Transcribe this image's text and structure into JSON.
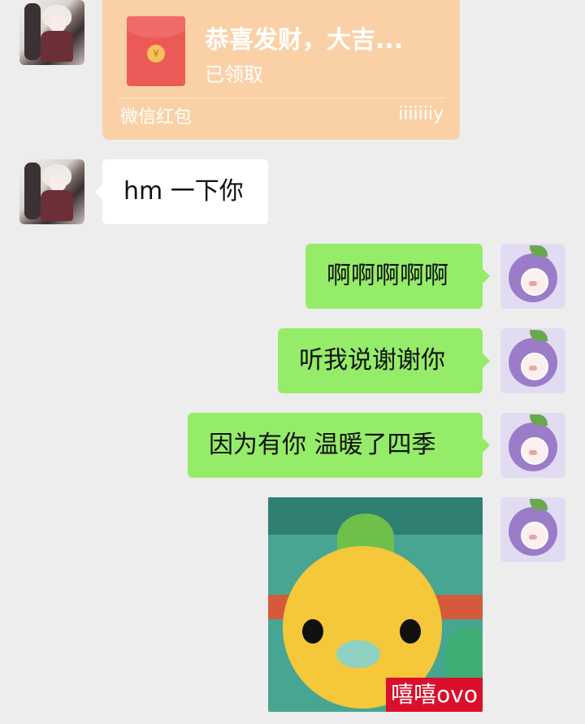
{
  "redpacket": {
    "title": "恭喜发财，大吉...",
    "status": "已领取",
    "label": "微信红包",
    "sender": "iiiiiiiy",
    "coin": "¥"
  },
  "messages": {
    "m1": "hm 一下你",
    "m2": "啊啊啊啊啊",
    "m3": "听我说谢谢你",
    "m4": "因为有你 温暖了四季"
  },
  "sticker": {
    "caption": "嘻嘻ovo"
  },
  "colors": {
    "outgoing_bubble": "#95ec69",
    "incoming_bubble": "#ffffff",
    "redpacket": "#fad1a7",
    "background": "#ededed"
  }
}
